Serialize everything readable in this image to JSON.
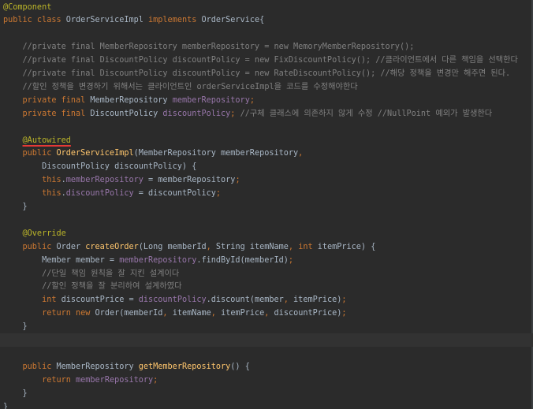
{
  "lines": [
    [
      [
        "ann",
        "@Component"
      ]
    ],
    [
      [
        "kw",
        "public class "
      ],
      [
        "plain",
        "OrderServiceImpl "
      ],
      [
        "kw",
        "implements "
      ],
      [
        "plain",
        "OrderService{"
      ]
    ],
    [],
    [
      [
        "cm",
        "    //private final MemberRepository memberRepository = new MemoryMemberRepository();"
      ]
    ],
    [
      [
        "cm",
        "    //private final DiscountPolicy discountPolicy = new FixDiscountPolicy(); //클라이언트에서 다른 책임을 선택한다"
      ]
    ],
    [
      [
        "cm",
        "    //private final DiscountPolicy discountPolicy = new RateDiscountPolicy(); //해당 정책을 변경만 해주면 된다."
      ]
    ],
    [
      [
        "cm",
        "    //할인 정책을 변경하기 위해서는 클라이언트인 orderServiceImpl을 코드를 수정해야한다"
      ]
    ],
    [
      [
        "kw",
        "    private final "
      ],
      [
        "plain",
        "MemberRepository "
      ],
      [
        "field",
        "memberRepository"
      ],
      [
        "kw",
        ";"
      ]
    ],
    [
      [
        "kw",
        "    private final "
      ],
      [
        "plain",
        "DiscountPolicy "
      ],
      [
        "field",
        "discountPolicy"
      ],
      [
        "kw",
        "; "
      ],
      [
        "cm",
        "//구체 클래스에 의존하지 않게 수정 //NullPoint 예외가 발생한다"
      ]
    ],
    [],
    [
      [
        "plain",
        "    "
      ],
      [
        "ann-red",
        "@Autowired"
      ]
    ],
    [
      [
        "kw",
        "    public "
      ],
      [
        "fn",
        "OrderServiceImpl"
      ],
      [
        "plain",
        "(MemberRepository memberRepository"
      ],
      [
        "kw",
        ","
      ]
    ],
    [
      [
        "plain",
        "        DiscountPolicy discountPolicy) {"
      ]
    ],
    [
      [
        "kw",
        "        this"
      ],
      [
        "plain",
        "."
      ],
      [
        "field",
        "memberRepository"
      ],
      [
        "plain",
        " = memberRepository"
      ],
      [
        "kw",
        ";"
      ]
    ],
    [
      [
        "kw",
        "        this"
      ],
      [
        "plain",
        "."
      ],
      [
        "field",
        "discountPolicy"
      ],
      [
        "plain",
        " = discountPolicy"
      ],
      [
        "kw",
        ";"
      ]
    ],
    [
      [
        "plain",
        "    }"
      ]
    ],
    [],
    [
      [
        "ann",
        "    @Override"
      ]
    ],
    [
      [
        "kw",
        "    public "
      ],
      [
        "plain",
        "Order "
      ],
      [
        "fn",
        "createOrder"
      ],
      [
        "plain",
        "(Long memberId"
      ],
      [
        "kw",
        ", "
      ],
      [
        "plain",
        "String itemName"
      ],
      [
        "kw",
        ", int "
      ],
      [
        "plain",
        "itemPrice) {"
      ]
    ],
    [
      [
        "plain",
        "        Member member = "
      ],
      [
        "field",
        "memberRepository"
      ],
      [
        "plain",
        ".findById(memberId)"
      ],
      [
        "kw",
        ";"
      ]
    ],
    [
      [
        "cm",
        "        //단일 책임 원칙을 잘 지킨 설계이다"
      ]
    ],
    [
      [
        "cm",
        "        //할인 정책을 잘 분리하여 설계하였다"
      ]
    ],
    [
      [
        "kw",
        "        int "
      ],
      [
        "plain",
        "discountPrice = "
      ],
      [
        "field",
        "discountPolicy"
      ],
      [
        "plain",
        ".discount(member"
      ],
      [
        "kw",
        ", "
      ],
      [
        "plain",
        "itemPrice)"
      ],
      [
        "kw",
        ";"
      ]
    ],
    [
      [
        "kw",
        "        return new "
      ],
      [
        "plain",
        "Order(memberId"
      ],
      [
        "kw",
        ", "
      ],
      [
        "plain",
        "itemName"
      ],
      [
        "kw",
        ", "
      ],
      [
        "plain",
        "itemPrice"
      ],
      [
        "kw",
        ", "
      ],
      [
        "plain",
        "discountPrice)"
      ],
      [
        "kw",
        ";"
      ]
    ],
    [
      [
        "plain",
        "    }"
      ]
    ],
    [],
    [],
    [
      [
        "kw",
        "    public "
      ],
      [
        "plain",
        "MemberRepository "
      ],
      [
        "fn",
        "getMemberRepository"
      ],
      [
        "plain",
        "() {"
      ]
    ],
    [
      [
        "kw",
        "        return "
      ],
      [
        "field",
        "memberRepository"
      ],
      [
        "kw",
        ";"
      ]
    ],
    [
      [
        "plain",
        "    }"
      ]
    ],
    [
      [
        "plain",
        "}"
      ]
    ]
  ],
  "current_line_index": 25
}
